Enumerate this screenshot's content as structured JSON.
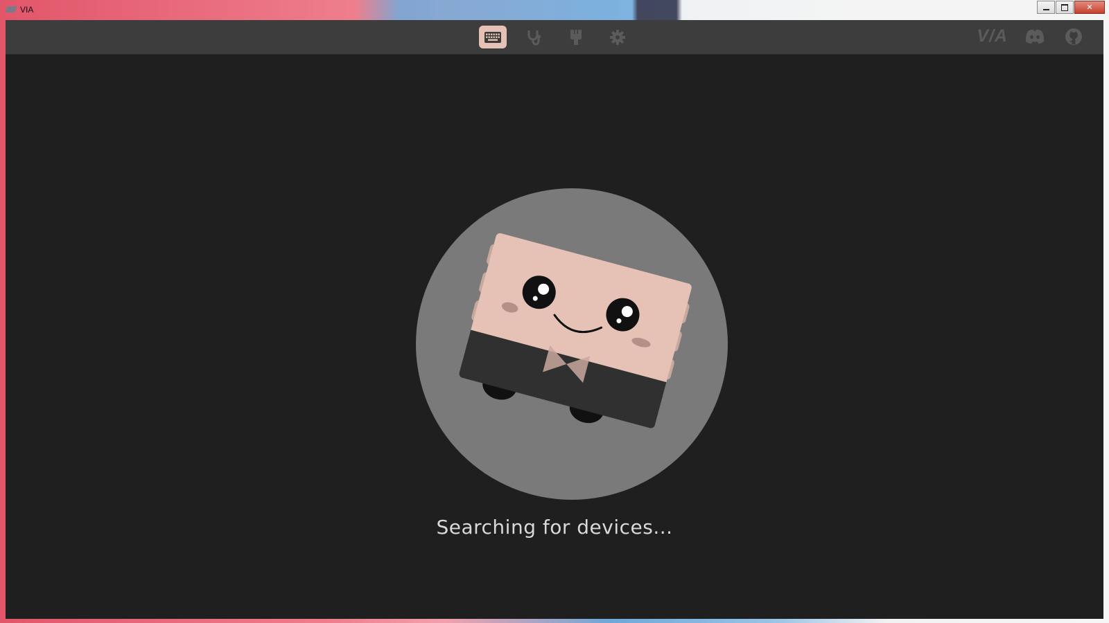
{
  "window": {
    "title": "VIA",
    "controls": [
      "minimize",
      "restore",
      "close"
    ],
    "close_glyph": "✕"
  },
  "topbar": {
    "nav": [
      {
        "name": "configure",
        "icon": "keyboard-icon",
        "active": true
      },
      {
        "name": "test",
        "icon": "stethoscope-icon",
        "active": false
      },
      {
        "name": "design",
        "icon": "paintbrush-icon",
        "active": false
      },
      {
        "name": "settings",
        "icon": "gear-icon",
        "active": false
      }
    ],
    "links": {
      "logo": "V/A",
      "discord_icon": "discord-icon",
      "github_icon": "github-icon"
    }
  },
  "main": {
    "status": "Searching for devices...",
    "mascot": "keyboard-mascot-illustration"
  },
  "colors": {
    "app_bg": "#1f1f20",
    "topbar_bg": "#3d3d3d",
    "accent": "#e6c1b5",
    "icon_muted": "#5b5b5b",
    "mascot_circle": "#7a7a7a"
  }
}
